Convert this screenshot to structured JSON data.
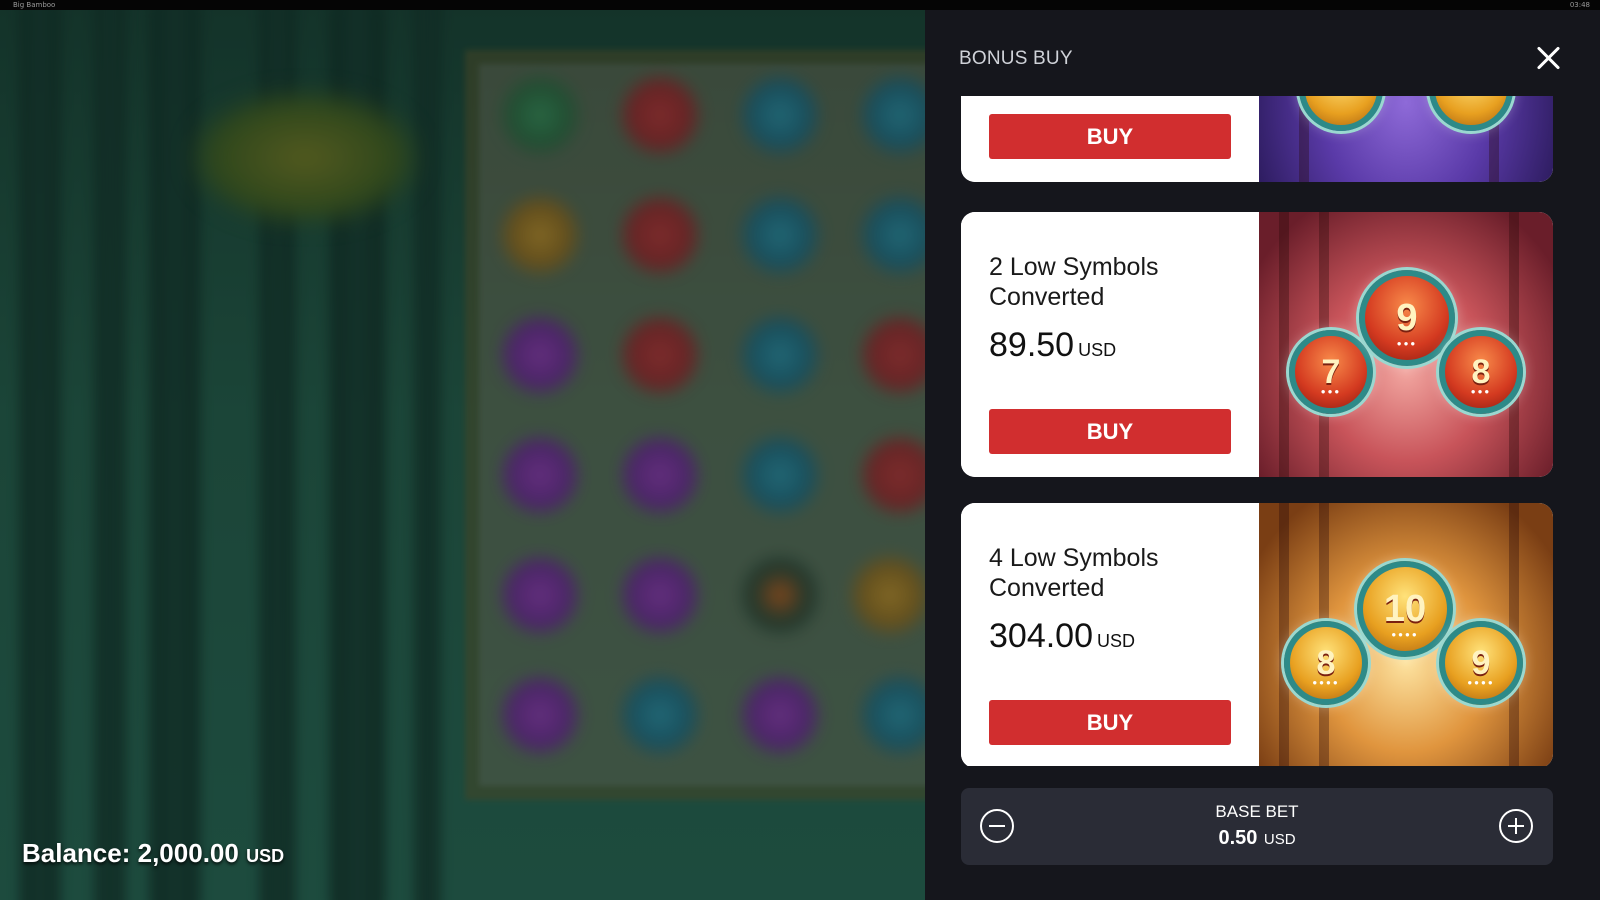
{
  "window": {
    "title": "Big Bamboo",
    "clock": "03:48"
  },
  "balance": {
    "label": "Balance:",
    "amount": "2,000.00",
    "currency": "USD"
  },
  "panel": {
    "title": "BONUS BUY",
    "close_icon": "close-icon",
    "offers": [
      {
        "name": "",
        "price": "",
        "currency": "",
        "buy_label": "BUY",
        "art": "purple"
      },
      {
        "name": "2 Low Symbols Converted",
        "price": "89.50",
        "currency": "USD",
        "buy_label": "BUY",
        "art": "pink",
        "coins": [
          "7",
          "9",
          "8"
        ]
      },
      {
        "name": "4 Low Symbols Converted",
        "price": "304.00",
        "currency": "USD",
        "buy_label": "BUY",
        "art": "amber",
        "coins": [
          "8",
          "10",
          "9"
        ]
      }
    ]
  },
  "base_bet": {
    "label": "BASE BET",
    "amount": "0.50",
    "currency": "USD",
    "minus_icon": "minus-circle-icon",
    "plus_icon": "plus-circle-icon"
  },
  "colors": {
    "buy_button": "#d12e2f",
    "panel_bg": "#15161c",
    "bet_bar_bg": "#2a2c36"
  }
}
